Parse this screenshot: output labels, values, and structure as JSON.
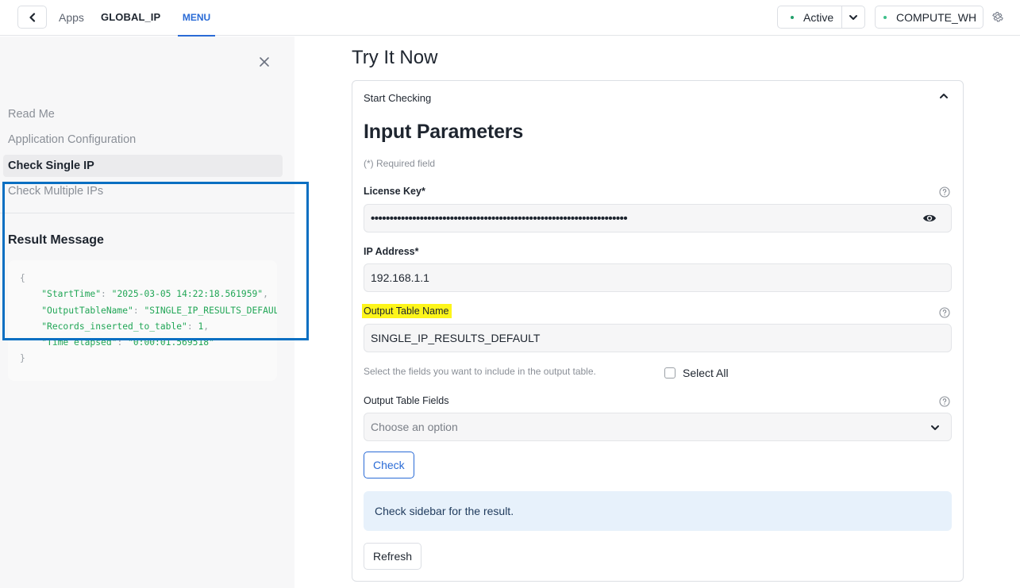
{
  "topbar": {
    "back_label": "Back",
    "breadcrumb_apps": "Apps",
    "app_name": "GLOBAL_IP",
    "tab_menu": "MENU",
    "status": "Active",
    "status_color": "#22a06b",
    "warehouse": "COMPUTE_WH",
    "warehouse_color": "#3dbf8a"
  },
  "sidebar": {
    "nav_items": [
      {
        "label": "Read Me",
        "active": false
      },
      {
        "label": "Application Configuration",
        "active": false
      },
      {
        "label": "Check Single IP",
        "active": true
      },
      {
        "label": "Check Multiple IPs",
        "active": false
      }
    ],
    "result": {
      "title": "Result Message",
      "open_brace": "{",
      "close_brace": "}",
      "lines": [
        {
          "key": "\"StartTime\"",
          "value": "\"2025-03-05 14:22:18.561959\"",
          "trail": ","
        },
        {
          "key": "\"OutputTableName\"",
          "value": "\"SINGLE_IP_RESULTS_DEFAULT\"",
          "trail": ","
        },
        {
          "key": "\"Records_inserted_to_table\"",
          "value": "1",
          "trail": ","
        },
        {
          "key": "\"Time elapsed\"",
          "value": "\"0:00:01.569518\"",
          "trail": ""
        }
      ]
    }
  },
  "main": {
    "page_title": "Try It Now",
    "card_header": "Start Checking",
    "section_title": "Input Parameters",
    "required_note": "(*) Required field",
    "fields": {
      "license_key": {
        "label": "License Key*",
        "value": "••••••••••••••••••••••••••••••••••••••••••••••••••••••••••••••••••••"
      },
      "ip_address": {
        "label": "IP Address*",
        "value": "192.168.1.1"
      },
      "output_table_name": {
        "label": "Output Table Name",
        "value": "SINGLE_IP_RESULTS_DEFAULT",
        "highlight_color": "#fdf51a"
      },
      "helper_text": "Select the fields you want to include in the output table.",
      "select_all": {
        "label": "Select All",
        "checked": false
      },
      "output_table_fields": {
        "label": "Output Table Fields",
        "placeholder": "Choose an option"
      }
    },
    "check_button": "Check",
    "alert_text": "Check sidebar for the result.",
    "refresh_button": "Refresh"
  }
}
